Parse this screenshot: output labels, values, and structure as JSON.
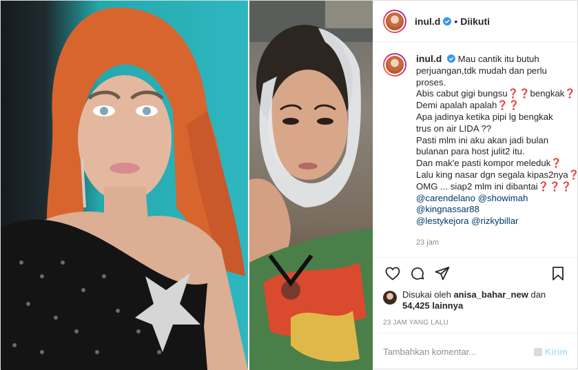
{
  "post": {
    "username": "inul.d",
    "separator": "•",
    "follow_label": "Diikuti",
    "caption_lines": [
      "Mau cantik itu butuh",
      "perjuangan,tdk mudah dan perlu",
      "proses.",
      "Abis cabut gigi bungsu❓❓bengkak❓❓",
      "Demi apalah apalah❓❓",
      "Apa jadinya ketika pipi lg bengkak",
      "trus on air LIDA ??",
      "Pasti mlm ini aku akan jadi bulan",
      "bulanan para host julit2 itu.",
      "Dan mak'e pasti kompor meleduk❓",
      "Lalu king nasar dgn segala kipas2nya❓",
      "OMG ... siap2 mlm ini dibantai❓❓❓"
    ],
    "mentions": {
      "m1": "@carendelano",
      "m2": "@showimah",
      "m3": "@kingnassar88",
      "m4": "@lestykejora",
      "m5": "@rizkybillar"
    },
    "caption_time": "23 jam",
    "likes": {
      "prefix": "Disukai oleh",
      "liker": "anisa_bahar_new",
      "joiner": "dan",
      "count_text": "54,425 lainnya"
    },
    "timestamp": "23 JAM YANG LALU",
    "comment_placeholder": "Tambahkan komentar...",
    "send_label": "Kirim"
  },
  "colors": {
    "verified": "#3897f0",
    "mention": "#00376b",
    "muted": "#8e8e8e",
    "send_disabled": "#b2dffc"
  },
  "icons": [
    "verified-badge-icon",
    "heart-icon",
    "comment-icon",
    "share-icon",
    "bookmark-icon",
    "send-icon"
  ]
}
